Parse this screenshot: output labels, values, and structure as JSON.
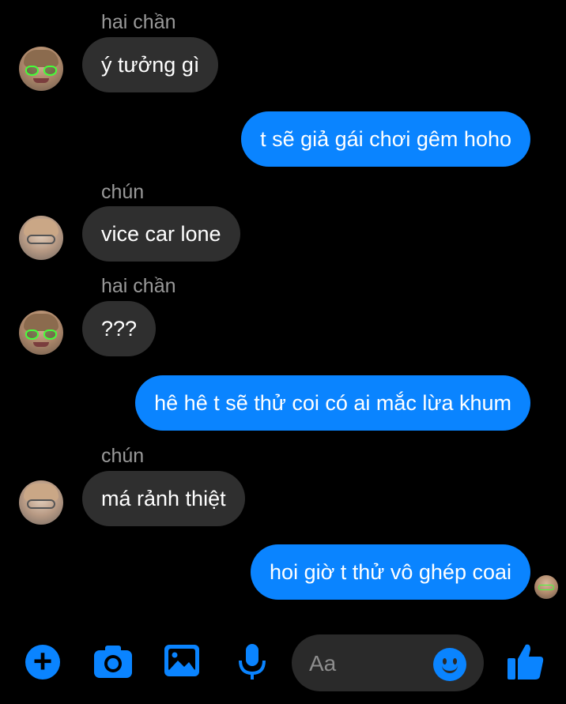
{
  "messages": [
    {
      "sender": "hai chần",
      "text": "ý tưởng gì"
    },
    {
      "text": "t sẽ giả gái chơi gêm hoho"
    },
    {
      "sender": "chún",
      "text": "vice car lone"
    },
    {
      "sender": "hai chần",
      "text": "???"
    },
    {
      "text": "hê hê t sẽ thử coi có ai mắc lừa khum"
    },
    {
      "sender": "chún",
      "text": "má rảnh thiệt"
    },
    {
      "text": "hoi giờ t thử vô ghép coai"
    }
  ],
  "composer": {
    "placeholder": "Aa"
  },
  "icons": {
    "add": "plus-icon",
    "camera": "camera-icon",
    "gallery": "image-icon",
    "voice": "microphone-icon",
    "emoji": "smiley-icon",
    "like": "thumbs-up-icon"
  },
  "colors": {
    "accent": "#0a84ff",
    "incoming_bubble": "#2f2f2f",
    "background": "#000000"
  }
}
